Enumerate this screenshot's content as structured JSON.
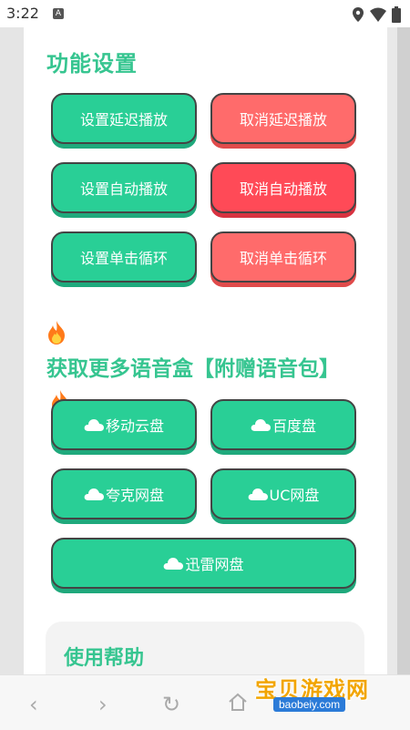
{
  "status": {
    "time": "3:22",
    "a_icon": "A"
  },
  "settings": {
    "title": "功能设置",
    "buttons": [
      "设置延迟播放",
      "取消延迟播放",
      "设置自动播放",
      "取消自动播放",
      "设置单击循环",
      "取消单击循环"
    ]
  },
  "more": {
    "title": "获取更多语音盒【附赠语音包】",
    "buttons": [
      "移动云盘",
      "百度盘",
      "夸克网盘",
      "UC网盘",
      "迅雷网盘"
    ]
  },
  "help": {
    "title": "使用帮助"
  },
  "watermark": {
    "text": "宝贝游戏网",
    "url": "baobeiy.com"
  },
  "colors": {
    "green": "#29cf96",
    "red": "#ff6b6b",
    "red_active": "#ff4a57",
    "title": "#36c590"
  }
}
